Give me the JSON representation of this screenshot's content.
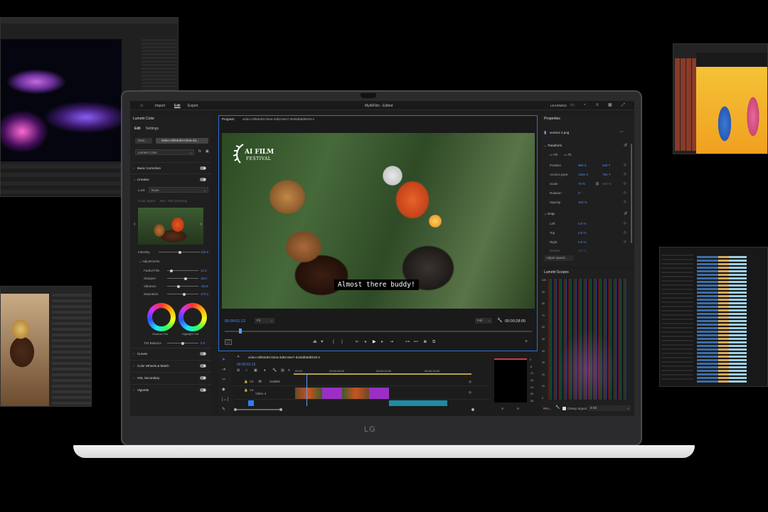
{
  "screen": {
    "menu": [
      "Import",
      "Edit",
      "Export"
    ],
    "active_menu": "Edit",
    "title": "MyAIFilm - Edited",
    "workspace": "LEARNING"
  },
  "lumetri": {
    "panel_title": "Lumetri Color",
    "tabs": [
      "Edit",
      "Settings"
    ],
    "source_label": "Sour...",
    "clip_label": "video-c5f54e93-02ea-4d...",
    "effect_select": "Lumetri Color",
    "sections_top": [
      "Basic Correction",
      "Creative"
    ],
    "look_label": "Look",
    "look_value": "None",
    "color_space_label": "Color Space",
    "color_space_value": "Rec. 709 (Gamma)",
    "intensity_label": "Intensity",
    "intensity_value": "100.0",
    "adjustments_label": "Adjustments",
    "adjustments": [
      {
        "label": "Faded Film",
        "value": "12.2"
      },
      {
        "label": "Sharpen",
        "value": "18.0"
      },
      {
        "label": "Vibrance",
        "value": "-32.6"
      },
      {
        "label": "Saturation",
        "value": "173.2"
      }
    ],
    "shadow_tint": "Shadow Tint",
    "highlight_tint": "Highlight Tint",
    "tint_balance_label": "Tint Balance",
    "tint_balance_value": "0.0",
    "sections_bottom": [
      "Curves",
      "Color Wheels & Match",
      "HSL Secondary",
      "Vignette"
    ]
  },
  "program": {
    "label": "Program:",
    "clip": "video-c5f54e93-02ea-4d52-8ee7-d446db8d5919-4",
    "watermark_line1": "AI FILM",
    "watermark_line2": "FESTIVAL",
    "subtitle": "Almost there buddy!",
    "timecode_current": "00:00:01:12",
    "fit": "Fit",
    "full": "Full",
    "timecode_duration": "00:00:28:05"
  },
  "properties": {
    "panel_title": "Properties",
    "file": "scene1-1.png",
    "transform_label": "Transform",
    "fill_label": "Fill",
    "fit_label": "Fit",
    "rows": [
      {
        "label": "Position",
        "v1": "960 X",
        "v2": "540 Y"
      },
      {
        "label": "Anchor point",
        "v1": "1340 X",
        "v2": "754 Y"
      },
      {
        "label": "Scale",
        "v1": "72 %",
        "v2": "100 %"
      },
      {
        "label": "Rotation",
        "v1": "0 °",
        "v2": ""
      },
      {
        "label": "Opacity",
        "v1": "100 %",
        "v2": ""
      }
    ],
    "crop_label": "Crop",
    "crop_rows": [
      {
        "label": "Left",
        "v1": "0.0 %"
      },
      {
        "label": "Top",
        "v1": "0.0 %"
      },
      {
        "label": "Right",
        "v1": "0.0 %"
      },
      {
        "label": "Bottom",
        "v1": "0.0 %"
      }
    ],
    "adjust_speed": "Adjust speed..."
  },
  "scopes": {
    "panel_title": "Lumetri Scopes",
    "ticks": [
      "100",
      "90",
      "80",
      "70",
      "60",
      "50",
      "40",
      "30",
      "20",
      "10",
      "0"
    ],
    "rec_label": "Rec...",
    "clamp_label": "Clamp Signal",
    "bits_value": "8 Bit"
  },
  "timeline": {
    "clip": "video-c5f54e93-02ea-4d52-8ee7-d446db8d5919-4",
    "timecode": "00:00:01:12",
    "ruler": [
      "00:00",
      "00:00:05:00",
      "00:00:10:00",
      "00:00:15:00"
    ],
    "tracks": [
      {
        "id": "V4",
        "name": "Subtitle"
      },
      {
        "id": "V4",
        "name": "Video 4"
      }
    ],
    "meter_ticks": [
      "0",
      "-6",
      "-12",
      "-18",
      "-24",
      "-30",
      "-36"
    ],
    "meter_bottom": [
      "S",
      "S"
    ]
  },
  "brand": "LG",
  "colors": {
    "accent": "#2f7df6",
    "clip_purple": "#9b2fc5",
    "clip_teal": "#1f8aa3",
    "playhead": "#5aa0ff"
  }
}
